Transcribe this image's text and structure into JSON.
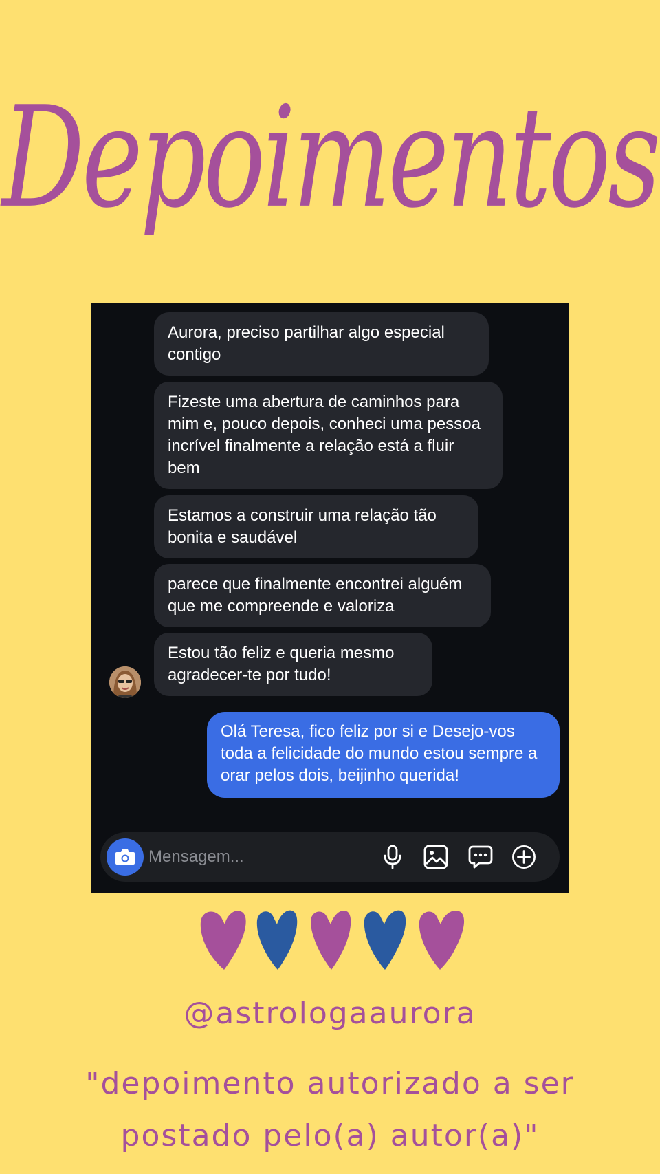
{
  "title": "Depoimentos",
  "chat": {
    "incoming": [
      "Aurora, preciso partilhar algo especial contigo",
      "Fizeste uma abertura de caminhos para mim e, pouco depois, conheci uma pessoa incrível finalmente a relação está a fluir bem",
      "Estamos a construir uma relação tão bonita e saudável",
      "parece que finalmente encontrei alguém que me compreende e valoriza",
      "Estou tão feliz e queria mesmo agradecer-te por tudo!"
    ],
    "outgoing": "Olá Teresa, fico feliz por si e Desejo-vos toda a felicidade do mundo estou sempre a orar pelos dois, beijinho querida!",
    "composer": {
      "placeholder": "Mensagem...",
      "icons": [
        "camera-icon",
        "microphone-icon",
        "image-icon",
        "sticker-icon",
        "add-icon"
      ]
    }
  },
  "hearts": {
    "colors": [
      "#a5509b",
      "#2a5aa0",
      "#a5509b",
      "#2a5aa0",
      "#a5509b"
    ]
  },
  "handle": "@astrologaaurora",
  "disclaimer_line1": "\"depoimento autorizado a ser",
  "disclaimer_line2": "postado pelo(a) autor(a)\"",
  "colors": {
    "background": "#fee070",
    "accent_purple": "#a5509b",
    "accent_blue": "#2a5aa0",
    "chat_background": "#0c0e12",
    "incoming_bubble": "#25272d",
    "outgoing_bubble": "#3a6de4"
  }
}
